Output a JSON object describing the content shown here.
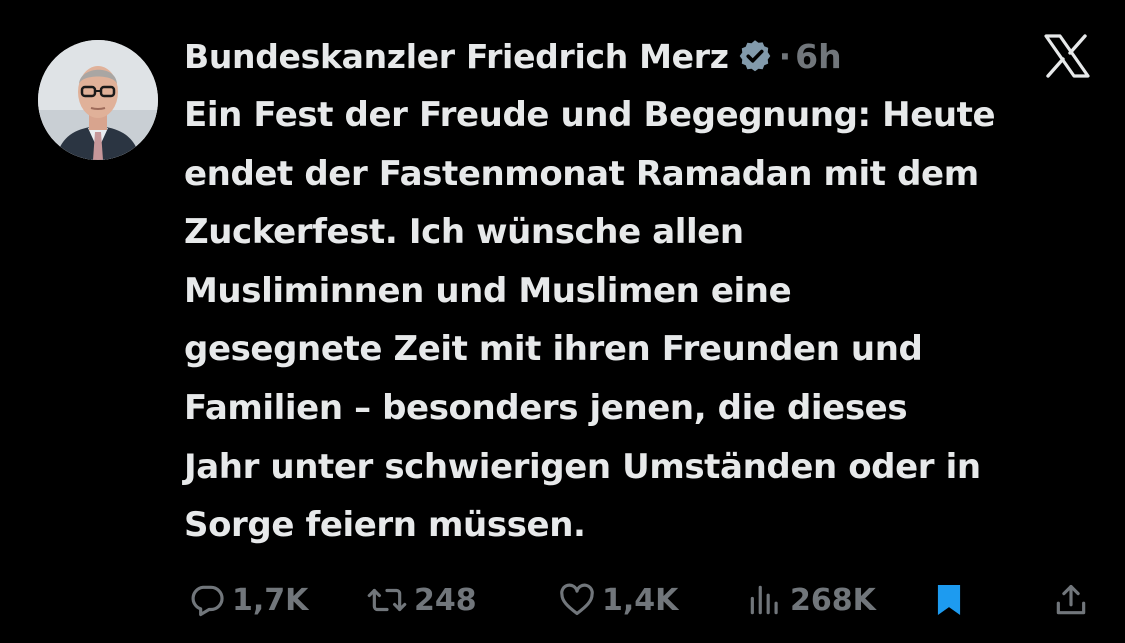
{
  "tweet": {
    "author_name": "Bundeskanzler Friedrich Merz",
    "separator": "·",
    "time": "6h",
    "text_lines": [
      "Ein Fest der Freude und Begegnung: Heute",
      "endet der Fastenmonat Ramadan mit dem",
      "Zuckerfest. Ich wünsche allen",
      "Musliminnen und Muslimen eine",
      "gesegnete Zeit mit ihren Freunden und",
      "Familien – besonders jenen, die dieses",
      "Jahr unter schwierigen Umständen oder in",
      "Sorge feiern müssen."
    ]
  },
  "metrics": {
    "replies": "1,7K",
    "reposts": "248",
    "likes": "1,4K",
    "views": "268K"
  },
  "icons": {
    "verified": "verified-badge-icon",
    "platform": "x-logo-icon",
    "reply": "reply-icon",
    "repost": "repost-icon",
    "like": "heart-icon",
    "views": "views-icon",
    "bookmark": "bookmark-icon",
    "share": "share-icon"
  },
  "colors": {
    "background": "#000000",
    "text": "#e7e9ea",
    "muted": "#71767b",
    "bookmark_active": "#1d9bf0",
    "verified_badge": "#829aab"
  }
}
